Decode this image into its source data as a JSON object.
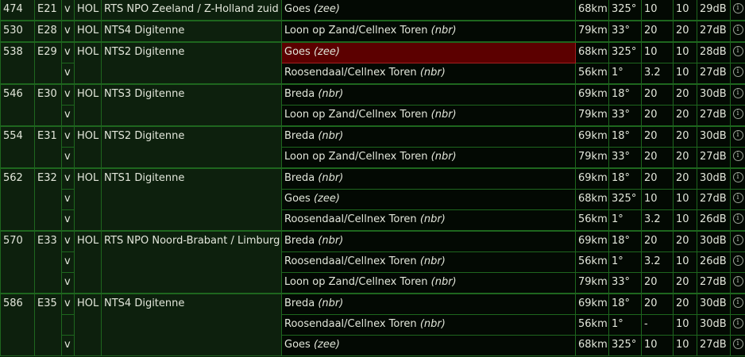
{
  "muxes": [
    {
      "channel": "474",
      "ch_code": "E21",
      "pol": "v",
      "country": "HOL",
      "name": "RTS NPO Zeeland / Z-Holland zuid",
      "tx": [
        {
          "pol": "v",
          "site": "Goes",
          "note": "(zee)",
          "dist": "68km",
          "bearing": "325°",
          "p1": "10",
          "p2": "10",
          "signal": "29dB",
          "info_icon": "info-icon"
        }
      ]
    },
    {
      "channel": "530",
      "ch_code": "E28",
      "pol": "v",
      "country": "HOL",
      "name": "NTS4 Digitenne",
      "tx": [
        {
          "pol": "v",
          "site": "Loon op Zand/Cellnex Toren",
          "note": "(nbr)",
          "dist": "79km",
          "bearing": "33°",
          "p1": "20",
          "p2": "20",
          "signal": "27dB",
          "info_icon": "info-icon"
        }
      ]
    },
    {
      "channel": "538",
      "ch_code": "E29",
      "pol": "v",
      "country": "HOL",
      "name": "NTS2 Digitenne",
      "tx": [
        {
          "pol": "v",
          "site": "Goes",
          "note": "(zee)",
          "dist": "68km",
          "bearing": "325°",
          "p1": "10",
          "p2": "10",
          "signal": "28dB",
          "info_icon": "info-icon",
          "highlight": true
        },
        {
          "pol": "v",
          "site": "Roosendaal/Cellnex Toren",
          "note": "(nbr)",
          "dist": "56km",
          "bearing": "1°",
          "p1": "3.2",
          "p2": "10",
          "signal": "27dB",
          "info_icon": "info-icon"
        }
      ]
    },
    {
      "channel": "546",
      "ch_code": "E30",
      "pol": "v",
      "country": "HOL",
      "name": "NTS3 Digitenne",
      "tx": [
        {
          "pol": "v",
          "site": "Breda",
          "note": "(nbr)",
          "dist": "69km",
          "bearing": "18°",
          "p1": "20",
          "p2": "20",
          "signal": "30dB",
          "info_icon": "info-icon"
        },
        {
          "pol": "v",
          "site": "Loon op Zand/Cellnex Toren",
          "note": "(nbr)",
          "dist": "79km",
          "bearing": "33°",
          "p1": "20",
          "p2": "20",
          "signal": "27dB",
          "info_icon": "info-icon"
        }
      ]
    },
    {
      "channel": "554",
      "ch_code": "E31",
      "pol": "v",
      "country": "HOL",
      "name": "NTS2 Digitenne",
      "tx": [
        {
          "pol": "v",
          "site": "Breda",
          "note": "(nbr)",
          "dist": "69km",
          "bearing": "18°",
          "p1": "20",
          "p2": "20",
          "signal": "30dB",
          "info_icon": "info-icon"
        },
        {
          "pol": "v",
          "site": "Loon op Zand/Cellnex Toren",
          "note": "(nbr)",
          "dist": "79km",
          "bearing": "33°",
          "p1": "20",
          "p2": "20",
          "signal": "27dB",
          "info_icon": "info-icon"
        }
      ]
    },
    {
      "channel": "562",
      "ch_code": "E32",
      "pol": "v",
      "country": "HOL",
      "name": "NTS1 Digitenne",
      "tx": [
        {
          "pol": "v",
          "site": "Breda",
          "note": "(nbr)",
          "dist": "69km",
          "bearing": "18°",
          "p1": "20",
          "p2": "20",
          "signal": "30dB",
          "info_icon": "info-icon"
        },
        {
          "pol": "v",
          "site": "Goes",
          "note": "(zee)",
          "dist": "68km",
          "bearing": "325°",
          "p1": "10",
          "p2": "10",
          "signal": "27dB",
          "info_icon": "info-icon"
        },
        {
          "pol": "v",
          "site": "Roosendaal/Cellnex Toren",
          "note": "(nbr)",
          "dist": "56km",
          "bearing": "1°",
          "p1": "3.2",
          "p2": "10",
          "signal": "26dB",
          "info_icon": "info-icon"
        }
      ]
    },
    {
      "channel": "570",
      "ch_code": "E33",
      "pol": "v",
      "country": "HOL",
      "name": "RTS NPO Noord-Brabant / Limburg",
      "tx": [
        {
          "pol": "v",
          "site": "Breda",
          "note": "(nbr)",
          "dist": "69km",
          "bearing": "18°",
          "p1": "20",
          "p2": "20",
          "signal": "30dB",
          "info_icon": "info-icon"
        },
        {
          "pol": "v",
          "site": "Roosendaal/Cellnex Toren",
          "note": "(nbr)",
          "dist": "56km",
          "bearing": "1°",
          "p1": "3.2",
          "p2": "10",
          "signal": "26dB",
          "info_icon": "info-icon"
        },
        {
          "pol": "v",
          "site": "Loon op Zand/Cellnex Toren",
          "note": "(nbr)",
          "dist": "79km",
          "bearing": "33°",
          "p1": "20",
          "p2": "20",
          "signal": "27dB",
          "info_icon": "info-icon"
        }
      ]
    },
    {
      "channel": "586",
      "ch_code": "E35",
      "pol": "v",
      "country": "HOL",
      "name": "NTS4 Digitenne",
      "tx": [
        {
          "pol": "v",
          "site": "Breda",
          "note": "(nbr)",
          "dist": "69km",
          "bearing": "18°",
          "p1": "20",
          "p2": "20",
          "signal": "30dB",
          "info_icon": "info-icon"
        },
        {
          "pol": "",
          "site": "Roosendaal/Cellnex Toren",
          "note": "(nbr)",
          "dist": "56km",
          "bearing": "1°",
          "p1": "-",
          "p2": "10",
          "signal": "30dB",
          "info_icon": "info-icon"
        },
        {
          "pol": "v",
          "site": "Goes",
          "note": "(zee)",
          "dist": "68km",
          "bearing": "325°",
          "p1": "10",
          "p2": "10",
          "signal": "27dB",
          "info_icon": "info-icon"
        }
      ]
    }
  ]
}
